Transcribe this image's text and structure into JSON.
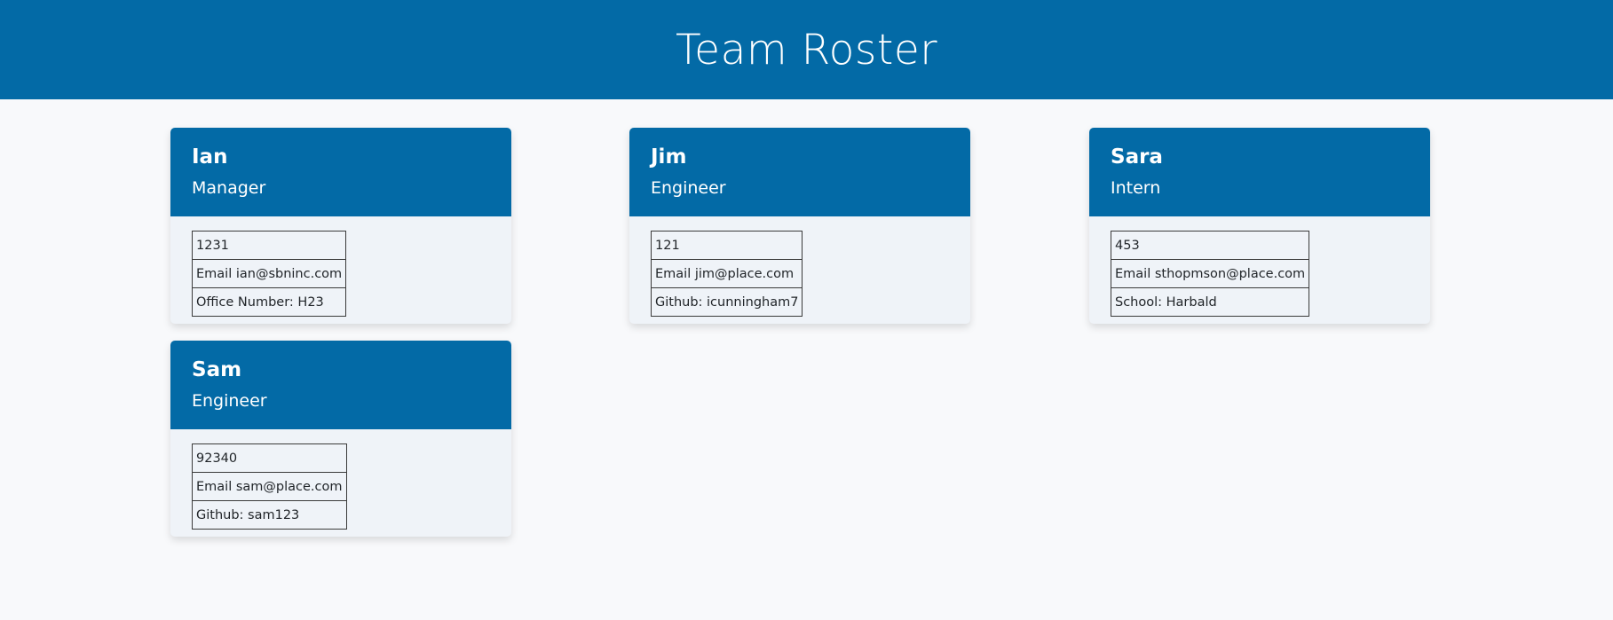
{
  "header": {
    "title": "Team Roster"
  },
  "employees": [
    {
      "name": "Ian",
      "role": "Manager",
      "id": "1231",
      "email_text": "Email ian@sbninc.com",
      "extra_text": "Office Number: H23"
    },
    {
      "name": "Jim",
      "role": "Engineer",
      "id": "121",
      "email_text": "Email jim@place.com",
      "extra_text": "Github: icunningham7"
    },
    {
      "name": "Sara",
      "role": "Intern",
      "id": "453",
      "email_text": "Email sthopmson@place.com",
      "extra_text": "School: Harbald"
    },
    {
      "name": "Sam",
      "role": "Engineer",
      "id": "92340",
      "email_text": "Email sam@place.com",
      "extra_text": "Github: sam123"
    }
  ],
  "colors": {
    "header_bg": "#036aa6",
    "card_body_bg": "#eff3f8",
    "page_bg": "#f8f9fb"
  }
}
